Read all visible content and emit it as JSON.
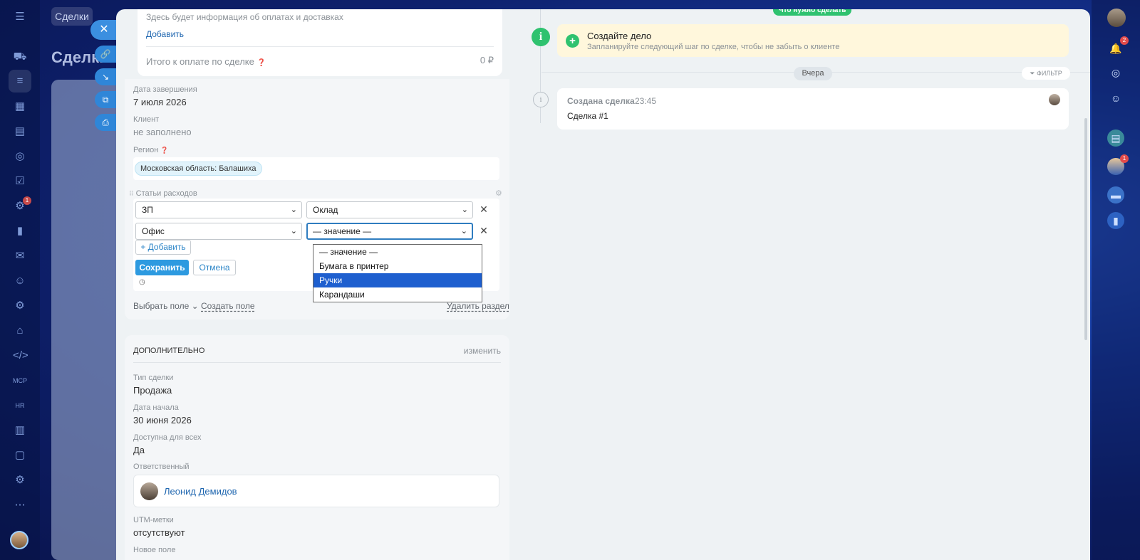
{
  "portal": {
    "deals_tab": "Сделки",
    "deals_title": "Сделки",
    "left_nav_badge": "1",
    "right_bar": {
      "notifications_badge": "2",
      "avatar_badge": "1"
    }
  },
  "payments": {
    "info_text": "Здесь будет информация об оплатах и доставках",
    "add_link": "Добавить",
    "total_label": "Итого к оплате по сделке",
    "total_value": "0 ₽"
  },
  "fields": {
    "completion_date_label": "Дата завершения",
    "completion_date_value": "7 июля 2026",
    "client_label": "Клиент",
    "client_value": "не заполнено",
    "region_label": "Регион",
    "region_chip": "Московская область: Балашиха"
  },
  "expenses": {
    "label": "Статьи расходов",
    "rows": [
      {
        "category": "ЗП",
        "value": "Оклад"
      },
      {
        "category": "Офис",
        "value": "— значение —"
      }
    ],
    "add_button": "+ Добавить",
    "dropdown_options": [
      "— значение —",
      "Бумага в принтер",
      "Ручки",
      "Карандаши"
    ],
    "dropdown_selected_index": 2,
    "save_button": "Сохранить",
    "cancel_button": "Отмена"
  },
  "section_footer": {
    "select_field": "Выбрать поле",
    "create_field": "Создать поле",
    "delete_section": "Удалить раздел"
  },
  "additional": {
    "title": "ДОПОЛНИТЕЛЬНО",
    "edit_link": "изменить",
    "deal_type_label": "Тип сделки",
    "deal_type_value": "Продажа",
    "start_date_label": "Дата начала",
    "start_date_value": "30 июня 2026",
    "available_label": "Доступна для всех",
    "available_value": "Да",
    "responsible_label": "Ответственный",
    "responsible_name": "Леонид Демидов",
    "utm_label": "UTM-метки",
    "utm_value": "отсутствуют",
    "new_field_label": "Новое поле"
  },
  "timeline": {
    "todo_pill": "Что нужно сделать",
    "create_title": "Создайте дело",
    "create_subtitle": "Запланируйте следующий шаг по сделке, чтобы не забыть о клиенте",
    "date_pill": "Вчера",
    "filter_label": "ФИЛЬТР",
    "event_title": "Создана сделка",
    "event_time": "23:45",
    "event_text": "Сделка #1"
  },
  "colors": {
    "accent": "#2d9ae0",
    "success": "#2fc26f",
    "dropdown_highlight": "#1e5fcf",
    "link": "#2067b0"
  }
}
